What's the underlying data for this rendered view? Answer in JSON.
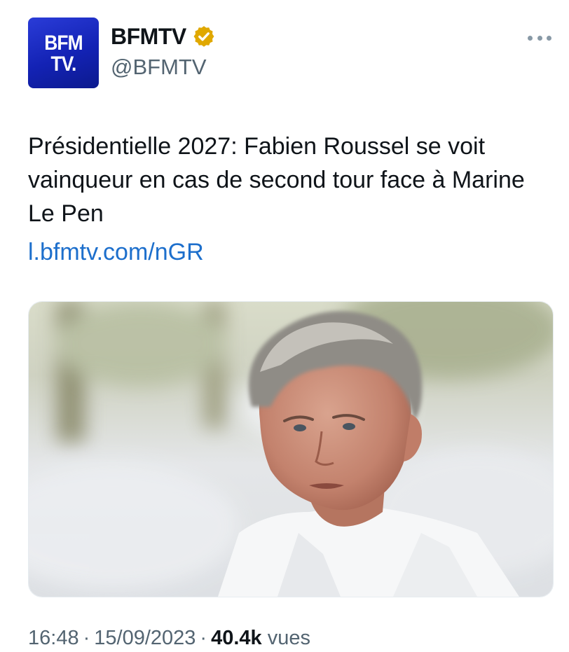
{
  "account": {
    "avatar_line1": "BFM",
    "avatar_line2": "TV.",
    "display_name": "BFMTV",
    "handle": "@BFMTV",
    "badge": "verified-gold-icon"
  },
  "tweet": {
    "text": "Présidentielle 2027: Fabien Roussel se voit vainqueur en cas de second tour face à Marine Le Pen",
    "link": "l.bfmtv.com/nGR"
  },
  "meta": {
    "time": "16:48",
    "date": "15/09/2023",
    "views_count": "40.4k",
    "views_label": "vues",
    "separator": "·"
  },
  "colors": {
    "brand": "#1b2bc8",
    "link": "#1d6fcc",
    "badge": "#e0a800",
    "muted": "#536471"
  }
}
